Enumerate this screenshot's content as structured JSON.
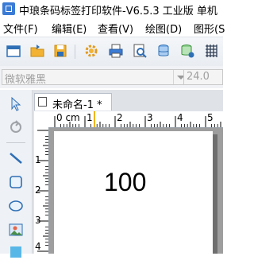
{
  "window": {
    "title": "中琅条码标签打印软件-V6.5.3 工业版 单机"
  },
  "menu": {
    "items": [
      "文件(F)",
      "编辑(E)",
      "查看(V)",
      "绘图(D)",
      "图形(S"
    ]
  },
  "font_row": {
    "font_name": "微软雅黑",
    "font_size": "24.0"
  },
  "document": {
    "tab_label": "未命名-1 *",
    "label_text": "100",
    "ruler_top_labels": [
      "0 cm",
      "1",
      "2",
      "3",
      "4",
      "5"
    ],
    "ruler_left_labels": [
      "1",
      "2",
      "3",
      "4"
    ]
  },
  "colors": {
    "accent": "#3a7bd5",
    "canvas_bg": "#9e9e9e"
  }
}
